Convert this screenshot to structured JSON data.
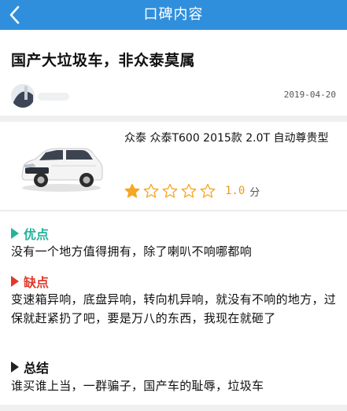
{
  "header": {
    "title": "口碑内容",
    "back_icon": "chevron-left-icon",
    "bg_color": "#2f8fdc"
  },
  "post": {
    "title": "国产大垃圾车，非众泰莫属",
    "date": "2019-04-20"
  },
  "car": {
    "name": "众泰 众泰T600 2015款 2.0T 自动尊贵型",
    "rating": {
      "stars_filled": 1,
      "stars_total": 5,
      "score": "1.0",
      "unit": "分",
      "star_color": "#f5a623"
    }
  },
  "sections": {
    "pros": {
      "label": "优点",
      "text": "没有一个地方值得拥有，除了喇叭不响哪都响",
      "color": "#24b39a"
    },
    "cons": {
      "label": "缺点",
      "text": "变速箱异响，底盘异响，转向机异响，就没有不响的地方，过保就赶紧扔了吧，要是万八的东西，我现在就砸了",
      "color": "#e0392b"
    },
    "summary": {
      "label": "总结",
      "text": "谁买谁上当，一群骗子，国产车的耻辱，垃圾车"
    }
  }
}
